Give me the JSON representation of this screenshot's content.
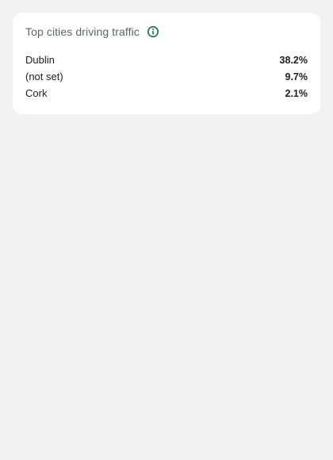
{
  "card": {
    "title": "Top cities driving traffic",
    "info_icon": "info-icon",
    "accent_color": "#137333",
    "rows": [
      {
        "city": "Dublin",
        "share": "38.2%"
      },
      {
        "city": "(not set)",
        "share": "9.7%"
      },
      {
        "city": "Cork",
        "share": "2.1%"
      }
    ]
  }
}
